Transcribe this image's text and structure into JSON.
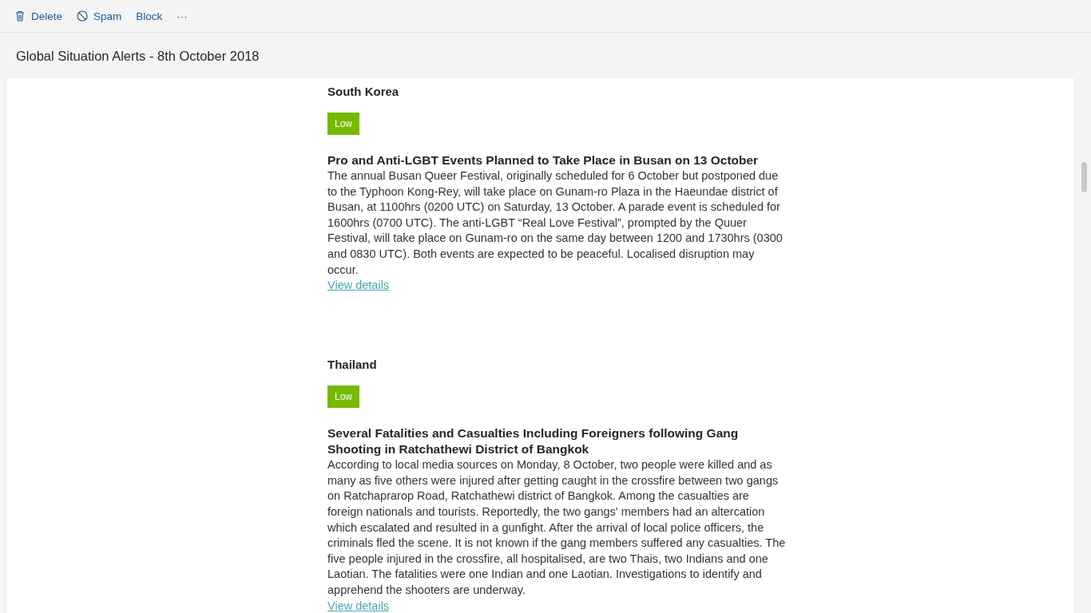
{
  "toolbar": [
    {
      "kind": "delete",
      "label": "Delete"
    },
    {
      "kind": "spam",
      "label": "Spam"
    },
    {
      "kind": "plain",
      "label": "Block"
    },
    {
      "kind": "plain",
      "label": "···"
    }
  ],
  "subject": "Global Situation Alerts - 8th October 2018",
  "alerts": [
    {
      "country": "South Korea",
      "badge": {
        "text": "Low",
        "color": "#76b900"
      },
      "headline": "Pro and Anti-LGBT Events Planned to Take Place in Busan on 13 October",
      "body": "The annual Busan Queer Festival, originally scheduled for 6 October but postponed due to the Typhoon Kong-Rey, will take place on Gunam-ro Plaza in the Haeundae district of Busan, at 1100hrs (0200 UTC) on Saturday, 13 October. A parade event is scheduled for 1600hrs (0700 UTC). The anti-LGBT “Real Love Festival”, prompted by the Quuer Festival, will take place on Gunam-ro on the same day between 1200 and 1730hrs (0300 and 0830 UTC). Both events are expected to be peaceful. Localised disruption may occur.",
      "link": "View details"
    },
    {
      "country": "Thailand",
      "badge": {
        "text": "Low",
        "color": "#76b900"
      },
      "headline": "Several Fatalities and Casualties Including Foreigners following Gang Shooting in Ratchathewi District of Bangkok",
      "body": "According to local media sources on Monday, 8 October, two people were killed and as many as five others were injured after getting caught in the crossfire between two gangs on Ratchaprarop Road, Ratchathewi district of Bangkok. Among the casualties are foreign nationals and tourists. Reportedly, the two gangs' members had an altercation which escalated and resulted in a gunfight. After the arrival of local police officers, the criminals fled the scene. It is not known if the gang members suffered any casualties. The five people injured in the crossfire, all hospitalised, are two Thais, two Indians and one Laotian. The fatalities were one Indian and one Laotian. Investigations to identify and apprehend the shooters are underway.",
      "link": "View details"
    }
  ]
}
